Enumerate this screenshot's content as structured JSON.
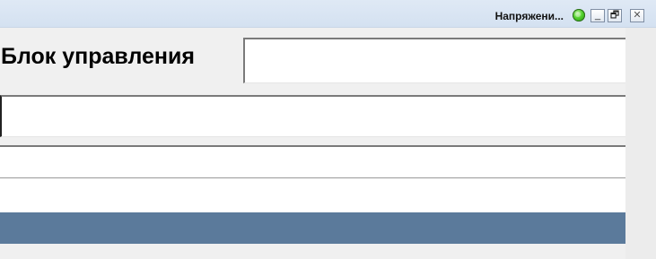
{
  "titlebar": {
    "title": "Напряжени...",
    "status_icon": "status-ok-icon",
    "buttons": {
      "minimize_glyph": "_",
      "restore_glyph": "🗗",
      "close_glyph": "✕"
    }
  },
  "main": {
    "block_label": "Блок управления",
    "block_input_value": "",
    "field_wide_value": "",
    "field_rows": [
      "",
      ""
    ]
  },
  "colors": {
    "titlebar": "#d4e1f1",
    "accent_bar": "#5b7a9b",
    "status_green": "#4fcf2a"
  }
}
